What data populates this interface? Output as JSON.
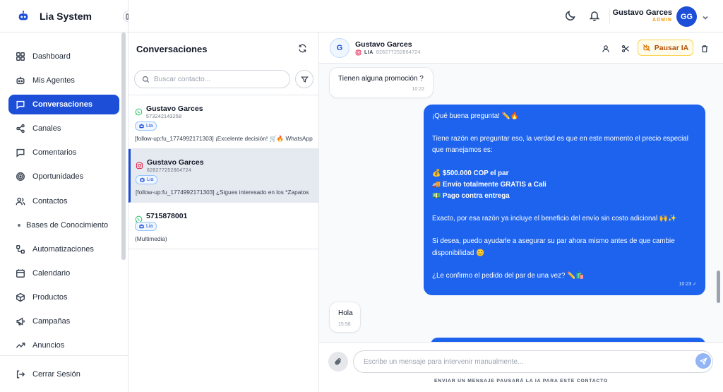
{
  "brand": {
    "name": "Lia System"
  },
  "sidebar": {
    "items": [
      {
        "label": "Dashboard",
        "icon": "grid-icon"
      },
      {
        "label": "Mis Agentes",
        "icon": "robot-icon"
      },
      {
        "label": "Conversaciones",
        "icon": "chat-icon",
        "active": true
      },
      {
        "label": "Canales",
        "icon": "share-icon"
      },
      {
        "label": "Comentarios",
        "icon": "comment-icon"
      },
      {
        "label": "Oportunidades",
        "icon": "target-icon"
      },
      {
        "label": "Contactos",
        "icon": "users-icon"
      },
      {
        "label": "Bases de Conocimiento",
        "icon": "dot-icon"
      },
      {
        "label": "Automatizaciones",
        "icon": "workflow-icon"
      },
      {
        "label": "Calendario",
        "icon": "calendar-icon"
      },
      {
        "label": "Productos",
        "icon": "box-icon"
      },
      {
        "label": "Campañas",
        "icon": "megaphone-icon"
      },
      {
        "label": "Anuncios",
        "icon": "trending-icon"
      }
    ],
    "logout_label": "Cerrar Sesión"
  },
  "user": {
    "name": "Gustavo Garces",
    "role": "ADMIN",
    "initials": "GG"
  },
  "conversations": {
    "title": "Conversaciones",
    "search_placeholder": "Buscar contacto...",
    "items": [
      {
        "name": "Gustavo Garces",
        "id": "573242143258",
        "tag": "Lia",
        "preview": "[follow-up:fu_1774992171303] ¡Excelente decisión! 🛒🔥 WhatsApp",
        "channel": "whatsapp"
      },
      {
        "name": "Gustavo Garces",
        "id": "828277252864724",
        "tag": "Lia",
        "preview": "[follow-up:fu_1774992171303] ¿Sigues interesado en los *Zapatos",
        "channel": "instagram",
        "active": true
      },
      {
        "name": "5715878001",
        "tag": "Lia",
        "preview": "(Multimedia)",
        "channel": "whatsapp"
      }
    ]
  },
  "chat": {
    "contact_initial": "G",
    "contact_name": "Gustavo Garces",
    "agent": "LIA",
    "contact_id": "828277252864724",
    "pause_label": "Pausar IA",
    "messages": {
      "in1": {
        "text": "Tienen alguna promoción ?",
        "time": "10:22"
      },
      "out1": {
        "l1": "¡Qué buena pregunta! ✏️🔥",
        "l2": "Tiene razón en preguntar eso, la verdad es que en este momento el precio especial que manejamos es:",
        "l3": "💰 $500.000 COP el par",
        "l4": "🚚 Envío totalmente GRATIS a Cali",
        "l5": "💵 Pago contra entrega",
        "l6": "Exacto, por esa razón ya incluye el beneficio del envío sin costo adicional 🙌✨",
        "l7": "Si desea, puedo ayudarle a asegurar su par ahora mismo antes de que cambie disponibilidad 😊",
        "l8": "¿Le confirmo el pedido del par de una vez? ✏️🛍️",
        "time": "10:23"
      },
      "in2": {
        "text": "Hola",
        "time": "15:58"
      }
    },
    "input_placeholder": "Escribe un mensaje para intervenir manualmente...",
    "hint": "ENVIAR UN MENSAJE PAUSARÁ LA IA PARA ESTE CONTACTO"
  },
  "colors": {
    "primary": "#1d4ed8",
    "bubble": "#1d63ed",
    "admin": "#f59e0b"
  }
}
